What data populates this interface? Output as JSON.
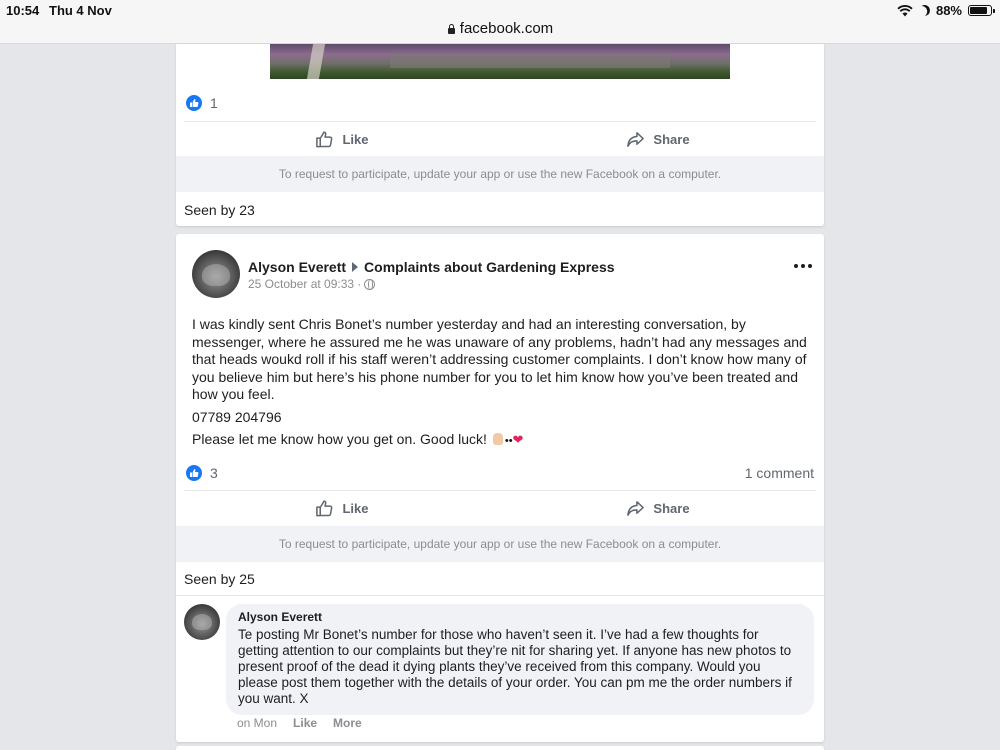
{
  "status_bar": {
    "time": "10:54",
    "date": "Thu 4 Nov",
    "url": "facebook.com",
    "battery": "88%"
  },
  "post1": {
    "reaction_count": "1",
    "like_label": "Like",
    "share_label": "Share",
    "participate_text": "To request to participate, update your app or use the new Facebook on a computer.",
    "seen_by": "Seen by 23"
  },
  "post2": {
    "author": "Alyson Everett",
    "group": "Complaints about Gardening Express",
    "timestamp": "25 October at 09:33 ·",
    "body": {
      "paragraph1": "I was kindly sent Chris Bonet’s number yesterday and had an interesting conversation, by messenger, where he assured me he was unaware of any problems, hadn’t had any messages and that heads woukd roll if his staff weren’t addressing customer complaints. I don’t know how many of you believe him but here’s his phone number for you to let him know how you’ve been treated and how you feel.",
      "phone": "07789 204796",
      "paragraph3": "Please let me know how you get on. Good luck!"
    },
    "reaction_count": "3",
    "comment_count": "1 comment",
    "like_label": "Like",
    "share_label": "Share",
    "participate_text": "To request to participate, update your app or use the new Facebook on a computer.",
    "seen_by": "Seen by 25",
    "comment": {
      "author": "Alyson Everett",
      "text": "Te posting Mr Bonet’s number for those who haven’t seen it. I’ve had a few thoughts for getting attention to our complaints but they’re nit for sharing yet. If anyone has new photos to present proof of the dead it dying plants they’ve received from this company. Would you please post them together with the details of your order. You can pm me the order numbers if you want. X",
      "time": "on Mon",
      "like_label": "Like",
      "more_label": "More"
    }
  },
  "colors": {
    "accent": "#1877f2",
    "page_bg": "#e4e6e9",
    "muted_text": "#606770"
  }
}
